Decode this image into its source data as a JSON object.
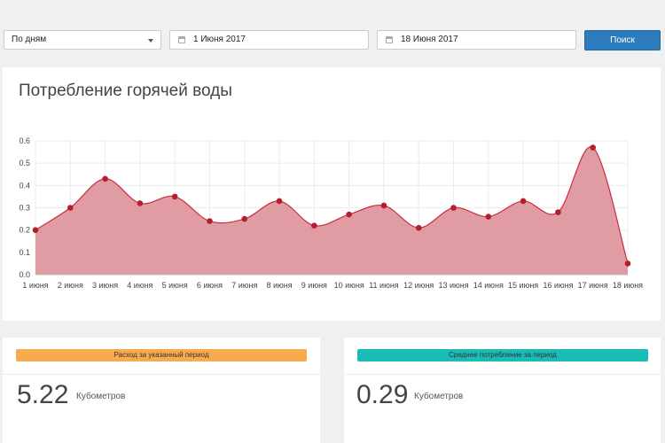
{
  "toolbar": {
    "period_select": "По дням",
    "date_from": "1 Июня 2017",
    "date_to": "18 Июня 2017",
    "search_label": "Поиск"
  },
  "chart_card": {
    "title": "Потребление горячей воды"
  },
  "chart_data": {
    "type": "area",
    "title": "Потребление горячей воды",
    "categories": [
      "1 июня",
      "2 июня",
      "3 июня",
      "4 июня",
      "5 июня",
      "6 июня",
      "7 июня",
      "8 июня",
      "9 июня",
      "10 июня",
      "11 июня",
      "12 июня",
      "13 июня",
      "14 июня",
      "15 июня",
      "16 июня",
      "17 июня",
      "18 июня"
    ],
    "series": [
      {
        "values": [
          0.2,
          0.3,
          0.43,
          0.32,
          0.35,
          0.24,
          0.25,
          0.33,
          0.22,
          0.27,
          0.31,
          0.21,
          0.3,
          0.26,
          0.33,
          0.28,
          0.57,
          0.05
        ]
      }
    ],
    "yticks": [
      "0.0",
      "0.1",
      "0.2",
      "0.3",
      "0.4",
      "0.5",
      "0.6"
    ],
    "ylim": [
      0,
      0.6
    ],
    "grid": true,
    "colors": {
      "fill": "#dc8a92",
      "line": "#c9303f",
      "point": "#b41e2d"
    }
  },
  "stats": {
    "period_total": {
      "label": "Расход за указанный период",
      "value": "5.22",
      "unit": "Кубометров",
      "color": "#f8ab4e"
    },
    "average": {
      "label": "Среднее потребление за период",
      "value": "0.29",
      "unit": "Кубометров",
      "color": "#1bbcb6"
    }
  }
}
